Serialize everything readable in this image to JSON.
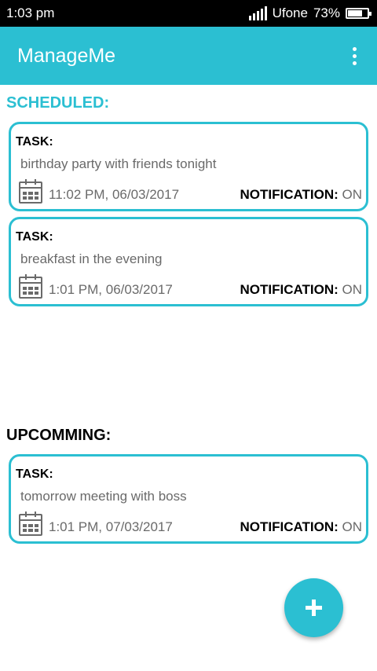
{
  "status_bar": {
    "time": "1:03 pm",
    "carrier": "Ufone",
    "battery": "73%",
    "battery_level": 0.73,
    "icons": [
      "signal-icon",
      "battery-icon"
    ]
  },
  "app_bar": {
    "title": "ManageMe",
    "menu_icon": "overflow-menu-icon"
  },
  "sections": {
    "scheduled": {
      "title": "SCHEDULED:",
      "tasks": [
        {
          "label": "TASK:",
          "text": "birthday party with friends tonight",
          "datetime": "11:02 PM, 06/03/2017",
          "notif_label": "NOTIFICATION:",
          "notif_value": "ON"
        },
        {
          "label": "TASK:",
          "text": "breakfast in the evening",
          "datetime": "1:01 PM, 06/03/2017",
          "notif_label": "NOTIFICATION:",
          "notif_value": "ON"
        }
      ]
    },
    "upcoming": {
      "title": "UPCOMMING:",
      "tasks": [
        {
          "label": "TASK:",
          "text": "tomorrow meeting with boss",
          "datetime": "1:01 PM, 07/03/2017",
          "notif_label": "NOTIFICATION:",
          "notif_value": "ON"
        }
      ]
    }
  },
  "fab": {
    "icon": "plus-icon"
  },
  "colors": {
    "accent": "#2bbfd2",
    "secondary_text": "#6a6a6a",
    "status_bar": "#000000"
  }
}
